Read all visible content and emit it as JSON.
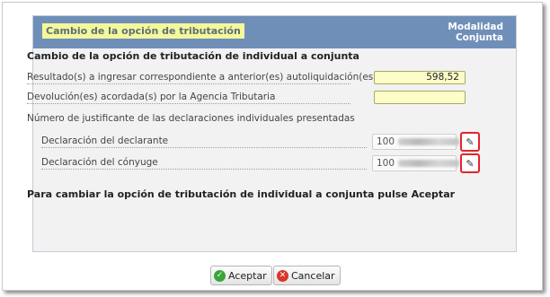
{
  "header": {
    "title": "Cambio de la opción de tributación",
    "modalidad_line1": "Modalidad",
    "modalidad_line2": "Conjunta"
  },
  "form": {
    "section_title": "Cambio de la opción de tributación de individual a conjunta",
    "resultado_label": "Resultado(s) a ingresar correspondiente a anterior(es) autoliquidación(es)",
    "resultado_value": "598,52",
    "devolucion_label": "Devolución(es) acordada(s) por la Agencia Tributaria",
    "devolucion_value": "",
    "justificante_label": "Número de justificante de las declaraciones individuales presentadas",
    "declarante_label": "Declaración del declarante",
    "declarante_value": "100",
    "conyuge_label": "Declaración del cónyuge",
    "conyuge_value": "100",
    "footer_note": "Para cambiar la opción de tributación de individual a conjunta pulse Aceptar"
  },
  "buttons": {
    "accept": "Aceptar",
    "cancel": "Cancelar"
  },
  "icons": {
    "edit": "pencil-icon",
    "accept": "check-icon",
    "cancel": "cross-icon"
  },
  "colors": {
    "header_bg": "#6f8fb9",
    "title_highlight": "#f4f89a",
    "edit_border": "#e4232a"
  }
}
